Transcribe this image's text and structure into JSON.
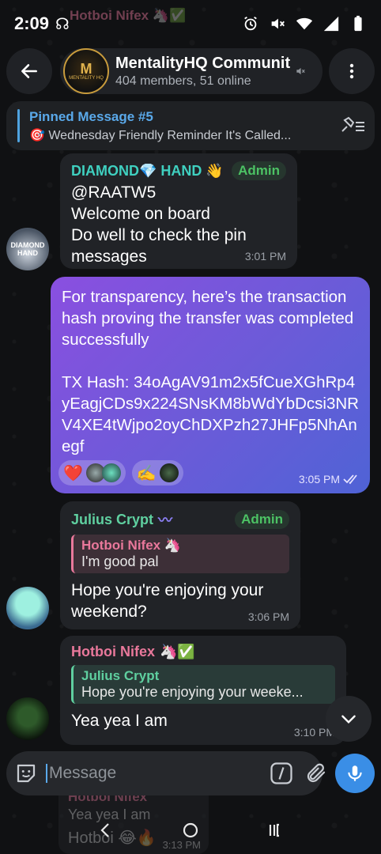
{
  "status_bar": {
    "time": "2:09",
    "app_glyph": "☊",
    "icons": [
      "alarm-icon",
      "mute-icon",
      "wifi-icon",
      "signal-icon",
      "battery-icon"
    ]
  },
  "behind_header": {
    "name": "Hotboi Nifex",
    "emoji": "🦄✅",
    "text": "I'm good pal"
  },
  "header": {
    "title": "MentalityHQ Communit",
    "subtitle": "404 members, 51 online",
    "avatar_letter": "M",
    "avatar_caption": "MENTALITY HQ"
  },
  "pinned": {
    "title": "Pinned Message #5",
    "preview": "🎯 Wednesday Friendly Reminder It's Called..."
  },
  "messages": {
    "m1": {
      "sender": "DIAMOND💎 HAND 👋",
      "badge": "Admin",
      "text": "@RAATW5\nWelcome on board\nDo well to check the pin messages",
      "time": "3:01 PM",
      "avatar_label": "DIAMOND HAND"
    },
    "m2": {
      "text": "For transparency, here’s the transaction hash proving the transfer was completed successfully\n\nTX Hash: 34oAgAV91m2x5fCueXGhRp4yEagjCDs9x224SNsKM8bWdYbDcsi3NRV4XE4tWjpo2oyChDXPzh27JHFp5NhAnegf",
      "time": "3:05 PM",
      "reaction_1": "❤️",
      "reaction_2": "✍️"
    },
    "m3": {
      "sender": "Julius Crypt",
      "sender_emoji": "〰",
      "badge": "Admin",
      "reply_name": "Hotboi Nifex",
      "reply_emoji": "🦄",
      "reply_text": "I'm good pal",
      "text": "Hope you're enjoying your weekend?",
      "time": "3:06 PM"
    },
    "m4": {
      "sender": "Hotboi Nifex",
      "sender_emoji": "🦄✅",
      "reply_name": "Julius Crypt",
      "reply_text": "Hope you're enjoying your weeke...",
      "text": "Yea yea I am",
      "time": "3:10 PM"
    }
  },
  "behind_composer": {
    "name": "Hotboi Nifex",
    "reply_text": "Yea yea I am",
    "text": "Hotboi 😂🔥",
    "time": "3:13 PM"
  },
  "composer": {
    "placeholder": "Message",
    "command_glyph": "/"
  },
  "colors": {
    "accent": "#5aa9ea",
    "admin": "#4cc264",
    "julius": "#5fd0a0",
    "hotboi": "#e9789b",
    "diamond": "#3fd0c0",
    "outgoing_start": "#8a4fe0",
    "outgoing_end": "#4f63d6"
  }
}
